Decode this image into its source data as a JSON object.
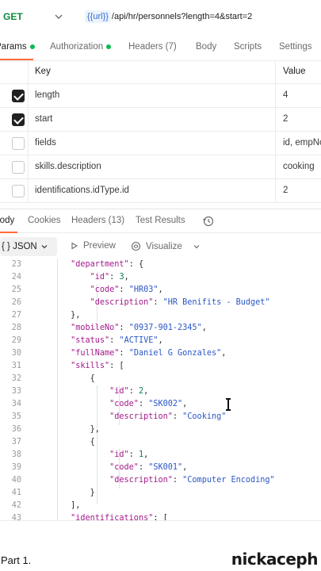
{
  "request": {
    "method": "GET",
    "url_variable": "{{url}}",
    "url_path": "/api/hr/personnels?length=4&start=2"
  },
  "request_tabs": [
    {
      "label": "Params",
      "dot": true,
      "active": true
    },
    {
      "label": "Authorization",
      "dot": true,
      "active": false
    },
    {
      "label": "Headers (7)",
      "dot": false,
      "active": false
    },
    {
      "label": "Body",
      "dot": false,
      "active": false
    },
    {
      "label": "Scripts",
      "dot": false,
      "active": false
    },
    {
      "label": "Settings",
      "dot": false,
      "active": false
    }
  ],
  "params": {
    "header_key": "Key",
    "header_value": "Value",
    "rows": [
      {
        "key": "length",
        "value": "4",
        "checked": true
      },
      {
        "key": "start",
        "value": "2",
        "checked": true
      },
      {
        "key": "fields",
        "value": "id, empNo",
        "checked": false
      },
      {
        "key": "skills.description",
        "value": "cooking",
        "checked": false
      },
      {
        "key": "identifications.idType.id",
        "value": "2",
        "checked": false
      }
    ]
  },
  "response_tabs": [
    {
      "label": "Body",
      "active": true
    },
    {
      "label": "Cookies",
      "active": false
    },
    {
      "label": "Headers (13)",
      "active": false
    },
    {
      "label": "Test Results",
      "active": false
    }
  ],
  "response_toolbar": {
    "format_label": "{ } JSON",
    "preview_label": "Preview",
    "visualize_label": "Visualize"
  },
  "code_lines": [
    {
      "n": "23",
      "text": "        \"department\": {"
    },
    {
      "n": "24",
      "text": "            \"id\": 3,"
    },
    {
      "n": "25",
      "text": "            \"code\": \"HR03\","
    },
    {
      "n": "26",
      "text": "            \"description\": \"HR Benifits - Budget\""
    },
    {
      "n": "27",
      "text": "        },"
    },
    {
      "n": "28",
      "text": "        \"mobileNo\": \"0937-901-2345\","
    },
    {
      "n": "29",
      "text": "        \"status\": \"ACTIVE\","
    },
    {
      "n": "30",
      "text": "        \"fullName\": \"Daniel G Gonzales\","
    },
    {
      "n": "31",
      "text": "        \"skills\": ["
    },
    {
      "n": "32",
      "text": "            {"
    },
    {
      "n": "33",
      "text": "                \"id\": 2,"
    },
    {
      "n": "34",
      "text": "                \"code\": \"SK002\","
    },
    {
      "n": "35",
      "text": "                \"description\": \"Cooking\""
    },
    {
      "n": "36",
      "text": "            },"
    },
    {
      "n": "37",
      "text": "            {"
    },
    {
      "n": "38",
      "text": "                \"id\": 1,"
    },
    {
      "n": "39",
      "text": "                \"code\": \"SK001\","
    },
    {
      "n": "40",
      "text": "                \"description\": \"Computer Encoding\""
    },
    {
      "n": "41",
      "text": "            }"
    },
    {
      "n": "42",
      "text": "        ],"
    },
    {
      "n": "43",
      "text": "        \"identifications\": ["
    }
  ],
  "footer": {
    "part_label": "Part 1.",
    "watermark": "nickaceph"
  },
  "colors": {
    "method": "#0b8a3e",
    "url_variable": "#2f6fce",
    "json_key": "#a31a8a",
    "json_string": "#2a56c6",
    "json_number": "#0e7a5b",
    "active_tab_underline": "#ff6c37",
    "dot": "#0cbb52"
  }
}
